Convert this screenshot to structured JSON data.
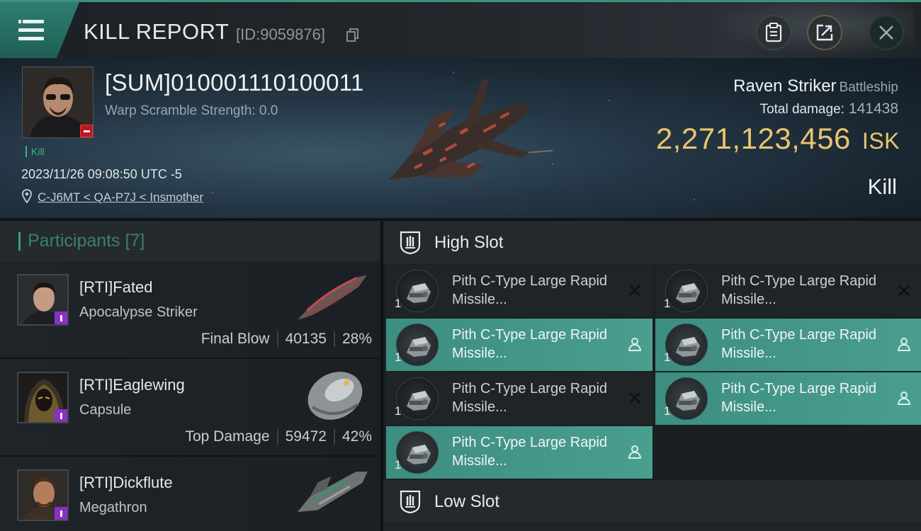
{
  "header": {
    "title": "KILL REPORT",
    "report_id": "[ID:9059876]"
  },
  "victim": {
    "pilot_name": "[SUM]010001110100011",
    "warp_scramble": "Warp Scramble Strength: 0.0",
    "kill_tag": "Kill",
    "datetime": "2023/11/26 09:08:50 UTC -5",
    "location": "C-J6MT < QA-P7J < Insmother",
    "ship_name": "Raven Striker",
    "ship_class": "Battleship",
    "total_damage_label": "Total damage:",
    "total_damage": "141438",
    "isk_value": "2,271,123,456",
    "isk_unit": "ISK",
    "result": "Kill"
  },
  "participants": {
    "label": "Participants [7]",
    "items": [
      {
        "name": "[RTI]Fated",
        "ship": "Apocalypse Striker",
        "role": "Final Blow",
        "damage": "40135",
        "percent": "28%"
      },
      {
        "name": "[RTI]Eaglewing",
        "ship": "Capsule",
        "role": "Top Damage",
        "damage": "59472",
        "percent": "42%"
      },
      {
        "name": "[RTI]Dickflute",
        "ship": "Megathron",
        "role": "",
        "damage": "",
        "percent": ""
      }
    ]
  },
  "fittings": {
    "high_slot_label": "High Slot",
    "low_slot_label": "Low Slot",
    "modules": [
      {
        "name": "Pith C-Type Large Rapid Missile...",
        "qty": "1",
        "status": "destroyed"
      },
      {
        "name": "Pith C-Type Large Rapid Missile...",
        "qty": "1",
        "status": "destroyed"
      },
      {
        "name": "Pith C-Type Large Rapid Missile...",
        "qty": "1",
        "status": "dropped"
      },
      {
        "name": "Pith C-Type Large Rapid Missile...",
        "qty": "1",
        "status": "dropped"
      },
      {
        "name": "Pith C-Type Large Rapid Missile...",
        "qty": "1",
        "status": "destroyed"
      },
      {
        "name": "Pith C-Type Large Rapid Missile...",
        "qty": "1",
        "status": "dropped"
      },
      {
        "name": "Pith C-Type Large Rapid Missile...",
        "qty": "1",
        "status": "dropped"
      }
    ]
  },
  "colors": {
    "accent": "#3c9f8d",
    "isk": "#e9c56e",
    "dropped": "#4a9e8f",
    "pilot_badge": "#8b2fc9",
    "victim_badge": "#c0171f"
  },
  "icons": {
    "menu": "hamburger-icon",
    "clipboard": "clipboard-icon",
    "share": "share-icon",
    "close": "close-icon",
    "copy": "copy-icon",
    "location": "map-pin-icon",
    "destroyed": "x-icon",
    "dropped": "person-icon",
    "slot": "slot-shield-icon"
  }
}
